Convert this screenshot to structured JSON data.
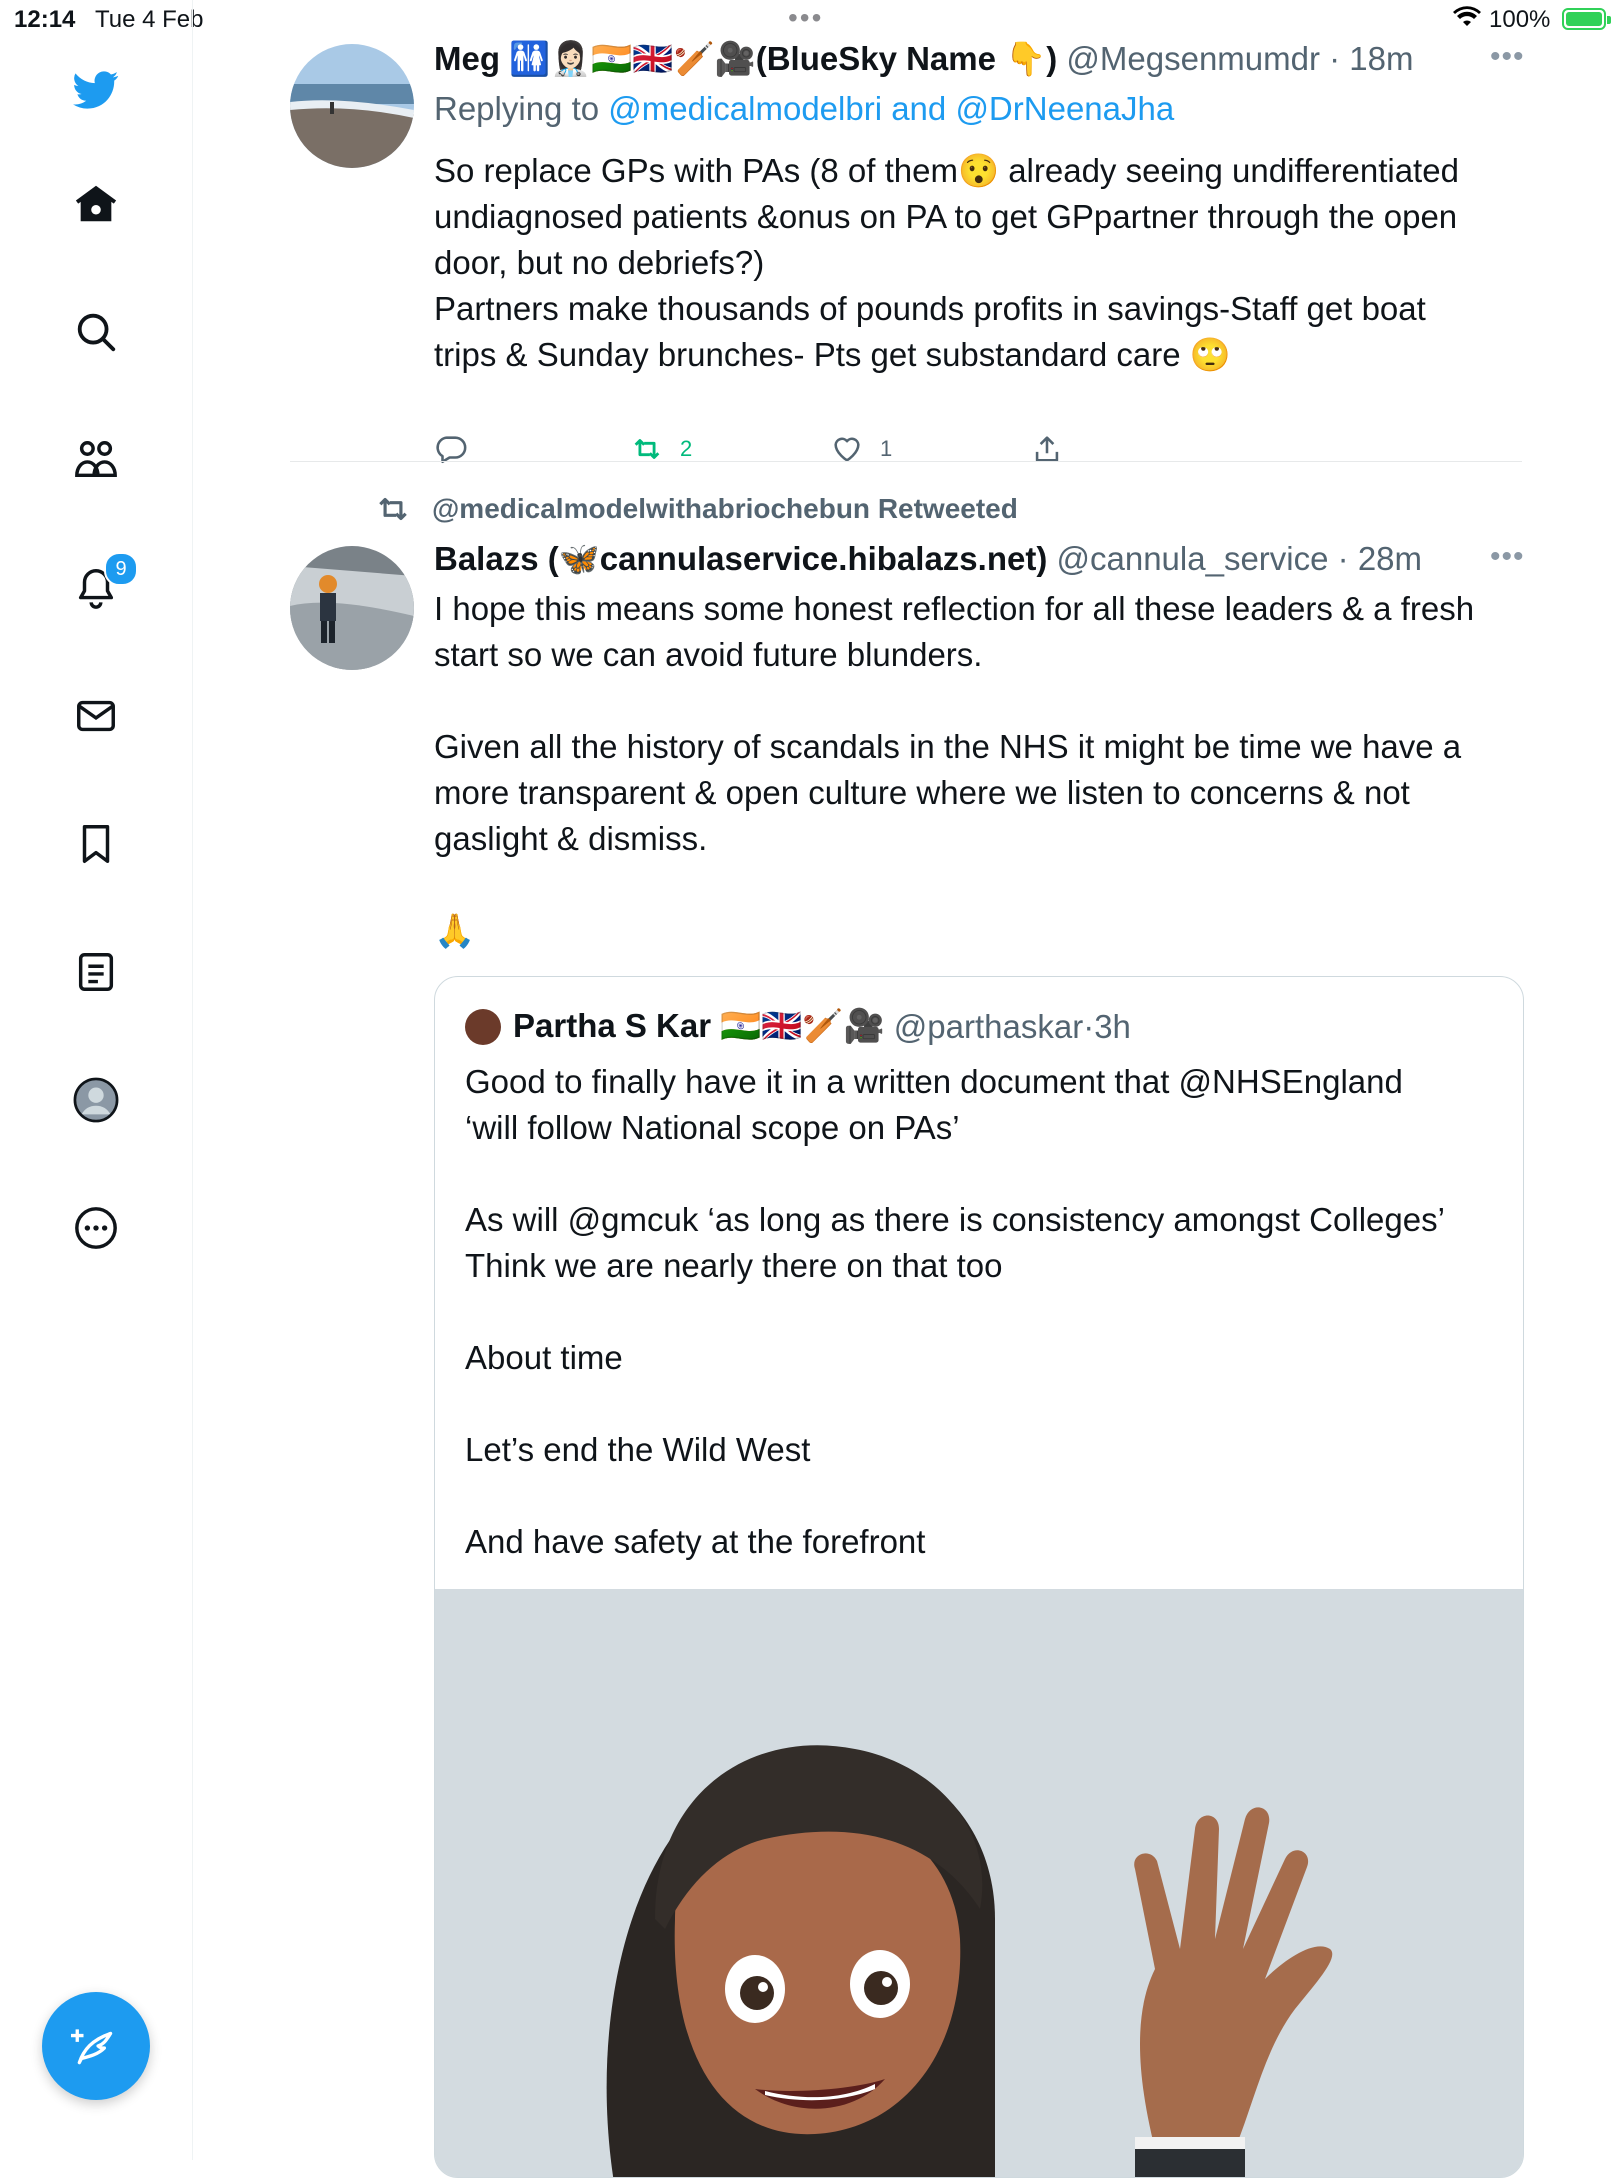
{
  "status_bar": {
    "time": "12:14",
    "date": "Tue 4 Feb",
    "battery": "100%"
  },
  "sidebar": {
    "items": [
      {
        "name": "twitter-logo-icon"
      },
      {
        "name": "home-icon"
      },
      {
        "name": "search-icon"
      },
      {
        "name": "communities-icon"
      },
      {
        "name": "notifications-icon",
        "badge": "9"
      },
      {
        "name": "messages-icon"
      },
      {
        "name": "bookmarks-icon"
      },
      {
        "name": "lists-icon"
      },
      {
        "name": "profile-icon"
      },
      {
        "name": "more-icon"
      }
    ],
    "compose": "compose-tweet-icon"
  },
  "tweets": [
    {
      "display_name": "Meg 🚻👩🏻‍⚕️🇮🇳🇬🇧🏏🎥(BlueSky Name 👇)",
      "handle": "@Megsenmumdr",
      "time": "18m",
      "replying_prefix": "Replying to ",
      "replying_to_1": "@medicalmodelbri",
      "replying_and": " and ",
      "replying_to_2": "@DrNeenaJha",
      "text": "So replace GPs with PAs (8 of them😯 already seeing undifferentiated\nundiagnosed patients &onus on PA to get GPpartner through the open\ndoor, but no debriefs?)\nPartners make thousands of pounds profits in savings-Staff get boat\ntrips & Sunday brunches- Pts get substandard care 🙄",
      "retweets": "2",
      "likes": "1"
    },
    {
      "retweeted_by": "@medicalmodelwithabriochebun Retweeted",
      "display_name": "Balazs (🦋cannulaservice.hibalazs.net)",
      "handle": "@cannula_service",
      "time": "28m",
      "text": "I hope this means some honest reflection for all these leaders & a fresh\nstart so we can avoid future blunders.\n\nGiven all the history of scandals in the NHS it might be time we have a\nmore transparent & open culture where we listen to concerns & not\ngaslight & dismiss.\n\n🙏",
      "quote": {
        "display_name": "Partha S Kar 🇮🇳🇬🇧🏏🎥",
        "handle": "@parthaskar",
        "time": "3h",
        "text": "Good to finally have it in a written document that @NHSEngland\n‘will follow National scope on PAs’\n\nAs will @gmcuk ‘as long as there is consistency amongst Colleges’\nThink we are nearly there on that too\n\nAbout time\n\nLet’s end the Wild West\n\nAnd have safety at the forefront"
      }
    }
  ],
  "colors": {
    "accent": "#1d9bf0",
    "retweet_green": "#00ba7c",
    "muted": "#536471"
  }
}
